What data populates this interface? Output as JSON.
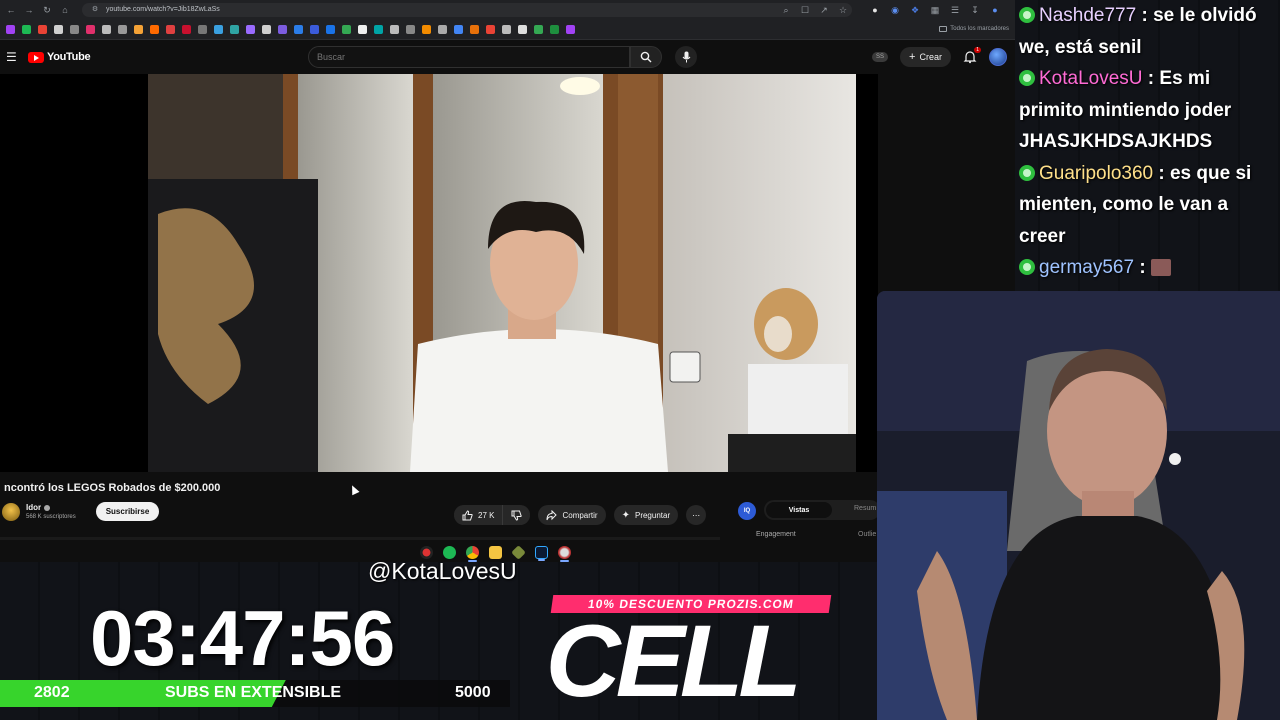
{
  "browser": {
    "url": "youtube.com/watch?v=Jib18ZwLaSs",
    "bookmarks_all_label": "Todos los marcadores"
  },
  "youtube": {
    "logo_text": "YouTube",
    "search_placeholder": "Buscar",
    "ss_badge": "SS",
    "create_label": "Crear",
    "notification_count": "1",
    "video": {
      "title": "ncontró los LEGOS Robados de $200.000",
      "channel_name": "Idor",
      "channel_subs": "568 K suscriptores",
      "subscribe_label": "Suscribirse",
      "likes": "27 K",
      "share_label": "Compartir",
      "ask_label": "Preguntar"
    },
    "side_panel": {
      "logo": "IQ",
      "tab_views": "Vistas",
      "tab_summary": "Resum",
      "engagement_label": "Engagement",
      "outlier_label": "Outlie"
    }
  },
  "stream": {
    "chat": [
      {
        "user": "Nashde777",
        "user_color": "#e7d0ff",
        "text": ": se le olvidó we, está senil"
      },
      {
        "user": "KotaLovesU",
        "user_color": "#ff6bd5",
        "text": ": Es mi primito mintiendo joder JHASJKHDSAJKHDS"
      },
      {
        "user": "Guaripolo360",
        "user_color": "#ffe08a",
        "text": ": es que si mienten, como le van a creer"
      },
      {
        "user": "germay567",
        "user_color": "#9fc3ff",
        "text": ":"
      }
    ],
    "handle": "@KotaLovesU",
    "timer": "03:47:56",
    "subs": {
      "current": "2802",
      "label": "SUBS EN EXTENSIBLE",
      "goal": "5000",
      "progress": 0.5604,
      "fill_color": "#37d42c"
    },
    "promo": {
      "banner": "10% DESCUENTO PROZIS.COM",
      "word": "CELL",
      "banner_color": "#ff2d6e"
    }
  }
}
